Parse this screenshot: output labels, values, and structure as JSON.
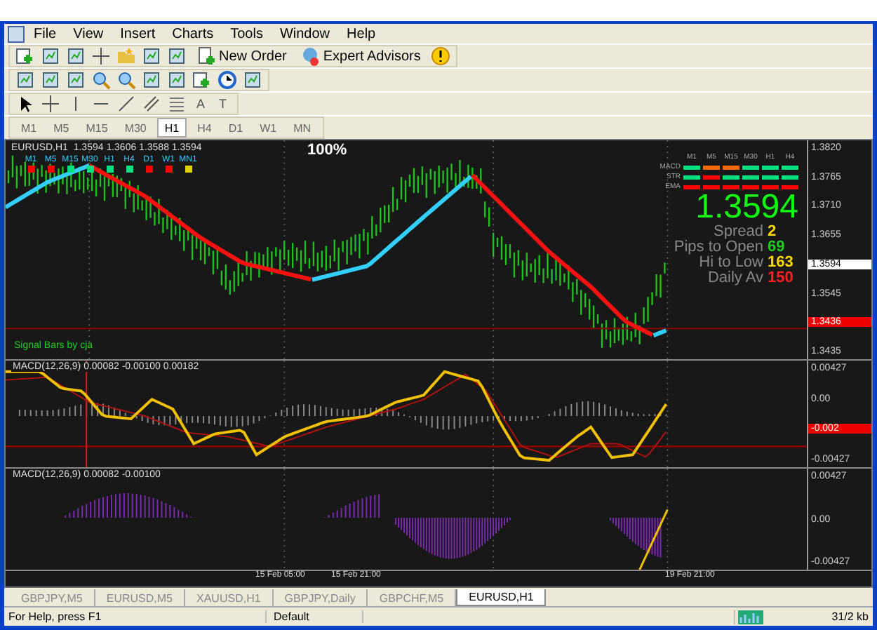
{
  "menu": [
    "File",
    "View",
    "Insert",
    "Charts",
    "Tools",
    "Window",
    "Help"
  ],
  "toolbar": {
    "buttons": [
      {
        "kind": "order",
        "label": "New Order"
      },
      {
        "kind": "experts",
        "label": "Expert Advisors"
      }
    ],
    "text_tools": [
      "A",
      "T"
    ],
    "timeframes": [
      {
        "label": "M1",
        "selected": false
      },
      {
        "label": "M5",
        "selected": false
      },
      {
        "label": "M15",
        "selected": false
      },
      {
        "label": "M30",
        "selected": false
      },
      {
        "label": "H1",
        "selected": true
      },
      {
        "label": "H4",
        "selected": false
      },
      {
        "label": "D1",
        "selected": false
      },
      {
        "label": "W1",
        "selected": false
      },
      {
        "label": "MN",
        "selected": false
      }
    ]
  },
  "chart": {
    "title": "EURUSD,H1  1.3594 1.3606 1.3588 1.3594",
    "zoom": "100%",
    "credit": "Signal Bars by cja",
    "signal_bars": [
      {
        "label": "M1",
        "color": "#ff0000"
      },
      {
        "label": "M5",
        "color": "#ff0000"
      },
      {
        "label": "M15",
        "color": "#00e080"
      },
      {
        "label": "M30",
        "color": "#00e080"
      },
      {
        "label": "H1",
        "color": "#00e080"
      },
      {
        "label": "H4",
        "color": "#00e080"
      },
      {
        "label": "D1",
        "color": "#ff0000"
      },
      {
        "label": "W1",
        "color": "#ff0000"
      },
      {
        "label": "MN1",
        "color": "#e0d000"
      }
    ],
    "dashboard": {
      "columns": [
        "M1",
        "M5",
        "M15",
        "M30",
        "H1",
        "H4"
      ],
      "rows": [
        {
          "label": "MACD",
          "cells": [
            {
              "color": "#00e080"
            },
            {
              "color": "#ff6a00"
            },
            {
              "color": "#ff6a00"
            },
            {
              "color": "#00e080"
            },
            {
              "color": "#00e080"
            },
            {
              "color": "#00e080"
            }
          ]
        },
        {
          "label": "STR",
          "cells": [
            {
              "color": "#00e080"
            },
            {
              "color": "#ff0000"
            },
            {
              "color": "#00e080"
            },
            {
              "color": "#00e080"
            },
            {
              "color": "#00e080"
            },
            {
              "color": "#00e080"
            }
          ]
        },
        {
          "label": "EMA",
          "cells": [
            {
              "color": "#ff0000"
            },
            {
              "color": "#ff0000"
            },
            {
              "color": "#ff0000"
            },
            {
              "color": "#ff0000"
            },
            {
              "color": "#ff0000"
            },
            {
              "color": "#ff0000"
            }
          ]
        }
      ]
    },
    "price": "1.3594",
    "stats": [
      {
        "label": "Spread",
        "value": "2",
        "color": "#ffd700"
      },
      {
        "label": "Pips to Open",
        "value": "69",
        "color": "#22cc22"
      },
      {
        "label": "Hi to Low",
        "value": "163",
        "color": "#ffd700"
      },
      {
        "label": "Daily Av",
        "value": "150",
        "color": "#ff2020"
      }
    ],
    "price_axis": [
      {
        "label": "1.3820",
        "kind": "plain"
      },
      {
        "label": "1.3765",
        "kind": "plain"
      },
      {
        "label": "1.3710",
        "kind": "plain"
      },
      {
        "label": "1.3655",
        "kind": "plain"
      },
      {
        "label": "1.3594",
        "kind": "current"
      },
      {
        "label": "1.3545",
        "kind": "plain"
      },
      {
        "label": "1.3436",
        "kind": "line"
      },
      {
        "label": "1.3435",
        "kind": "plain"
      }
    ]
  },
  "indicators": [
    {
      "title": "MACD(12,26,9) 0.00082 -0.00100 0.00182",
      "axis": [
        {
          "label": "0.00427",
          "kind": "plain"
        },
        {
          "label": "0.00",
          "kind": "plain"
        },
        {
          "label": "-0.002",
          "kind": "line"
        },
        {
          "label": "-0.00427",
          "kind": "plain"
        }
      ]
    },
    {
      "title": "MACD(12,26,9) 0.00082 -0.00100",
      "axis": [
        {
          "label": "0.00427",
          "kind": "plain"
        },
        {
          "label": "0.00",
          "kind": "plain"
        },
        {
          "label": "-0.00427",
          "kind": "plain"
        }
      ]
    }
  ],
  "time_axis": [
    "15 Feb 05:00",
    "15 Feb 21:00",
    "19 Feb 21:00"
  ],
  "tabs": [
    {
      "label": "GBPJPY,M5",
      "selected": false
    },
    {
      "label": "EURUSD,M5",
      "selected": false
    },
    {
      "label": "XAUUSD,H1",
      "selected": false
    },
    {
      "label": "GBPJPY,Daily",
      "selected": false
    },
    {
      "label": "GBPCHF,M5",
      "selected": false
    },
    {
      "label": "EURUSD,H1",
      "selected": true
    }
  ],
  "status_bar": {
    "help": "For Help, press F1",
    "profile": "Default",
    "traffic": "31/2 kb"
  }
}
